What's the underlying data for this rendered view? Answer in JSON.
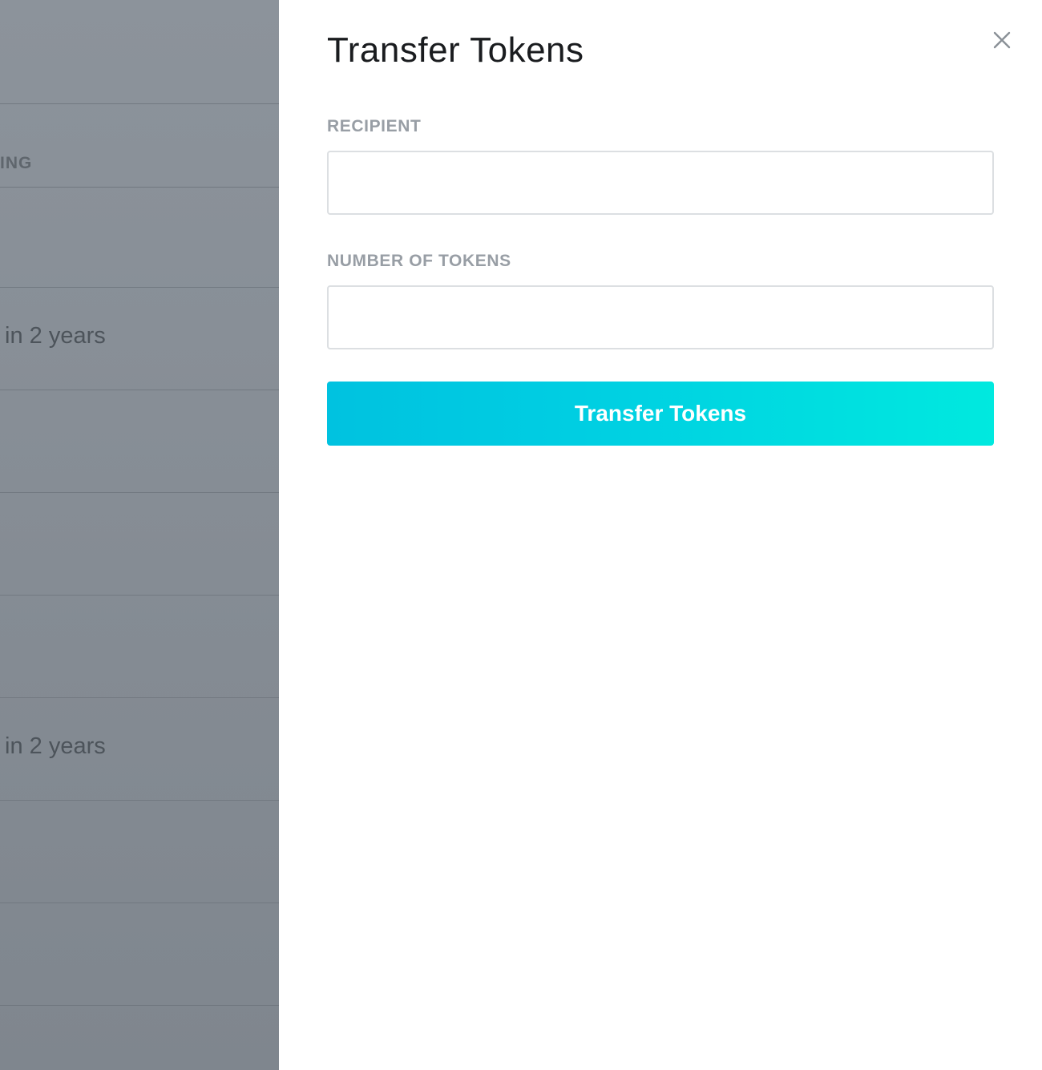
{
  "background_table": {
    "column_header_fragment": "ING",
    "rows": [
      {
        "cell_text": ""
      },
      {
        "cell_text": "in 2 years"
      },
      {
        "cell_text": ""
      },
      {
        "cell_text": ""
      },
      {
        "cell_text": ""
      },
      {
        "cell_text": "in 2 years"
      },
      {
        "cell_text": ""
      },
      {
        "cell_text": ""
      }
    ]
  },
  "drawer": {
    "title": "Transfer Tokens",
    "close_icon": "close-icon",
    "recipient": {
      "label": "RECIPIENT",
      "value": "",
      "placeholder": ""
    },
    "tokens": {
      "label": "NUMBER OF TOKENS",
      "value": "",
      "placeholder": ""
    },
    "submit_label": "Transfer Tokens",
    "colors": {
      "button_gradient_start": "#00c2e0",
      "button_gradient_end": "#00e9df",
      "overlay": "#858c94"
    }
  }
}
